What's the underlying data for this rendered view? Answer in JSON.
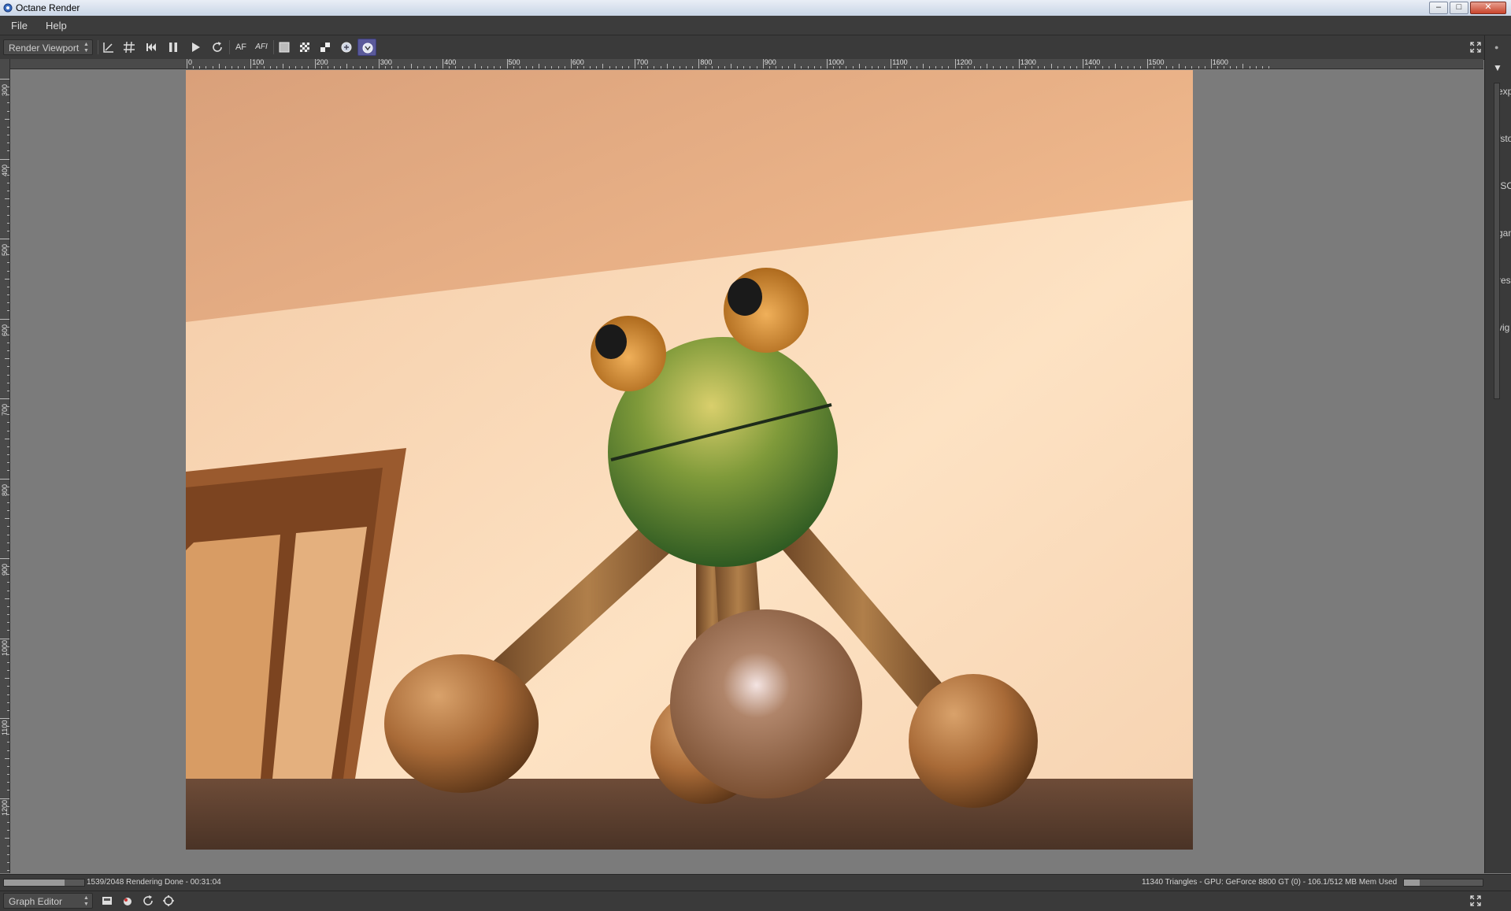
{
  "window": {
    "title": "Octane Render",
    "buttons": {
      "minimize": "–",
      "maximize": "□",
      "close": "✕"
    }
  },
  "menu": [
    "File",
    "Help"
  ],
  "toolbar": {
    "view_select": "Render Viewport",
    "buttons": [
      {
        "name": "pick-focus-icon",
        "label": ""
      },
      {
        "name": "grid-icon",
        "label": ""
      },
      {
        "name": "restart-icon",
        "label": ""
      },
      {
        "name": "pause-icon",
        "label": ""
      },
      {
        "name": "play-icon",
        "label": ""
      },
      {
        "name": "recompile-icon",
        "label": ""
      },
      {
        "name": "autofocus-button",
        "label": "AF"
      },
      {
        "name": "autofocus-infinity-button",
        "label": "AFI"
      },
      {
        "name": "region-render-icon",
        "label": ""
      },
      {
        "name": "checker-icon",
        "label": ""
      },
      {
        "name": "alpha-icon",
        "label": ""
      },
      {
        "name": "lock-icon",
        "label": ""
      },
      {
        "name": "realtime-icon",
        "label": ""
      }
    ]
  },
  "ruler_horizontal": [
    "0",
    "100",
    "200",
    "300",
    "400",
    "500",
    "600",
    "700",
    "800",
    "900",
    "1000",
    "1100",
    "1200",
    "1300",
    "1400",
    "1500",
    "1600"
  ],
  "ruler_vertical": [
    "300",
    "400",
    "500",
    "600",
    "700",
    "800",
    "900",
    "1000",
    "1100",
    "1200",
    "0"
  ],
  "right_panel_labels": [
    "exp",
    "fsto",
    "ISO",
    "gam",
    "resp",
    "vig"
  ],
  "status": {
    "left": "1539/2048 Rendering Done - 00:31:04",
    "right": "11340 Triangles - GPU: GeForce 8800 GT (0) - 106.1/512 MB Mem Used",
    "samples_progress": 0.75,
    "memory_progress": 0.2
  },
  "graph_editor": {
    "select": "Graph Editor"
  },
  "colors": {
    "accent": "#5a5a9a",
    "panel": "#3a3a3a",
    "viewport": "#7b7b7b"
  }
}
